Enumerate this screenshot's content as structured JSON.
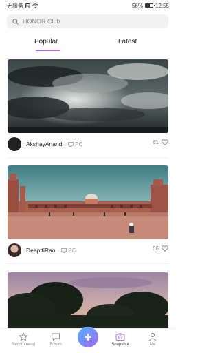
{
  "status_bar": {
    "carrier": "无服务",
    "battery": "56%",
    "battery_level": 0.56,
    "time": "12:55"
  },
  "search": {
    "placeholder": "HONOR Club"
  },
  "tabs": [
    {
      "label": "Popular",
      "active": true
    },
    {
      "label": "Latest",
      "active": false
    }
  ],
  "feed": [
    {
      "username": "AkshayAnand",
      "device": "PC",
      "likes": "61"
    },
    {
      "username": "DeepttiRao",
      "device": "PC",
      "likes": "56"
    },
    {
      "username": "",
      "device": "",
      "likes": ""
    }
  ],
  "bottom_nav": {
    "recommend": "Recommend",
    "forum": "Forum",
    "snapshot": "Snapshot",
    "me": "Me"
  },
  "colors": {
    "accent_gradient_start": "#7b6cf0",
    "accent_gradient_end": "#e06cc7",
    "add_button_start": "#4db3ff",
    "add_button_end": "#a566f0"
  }
}
